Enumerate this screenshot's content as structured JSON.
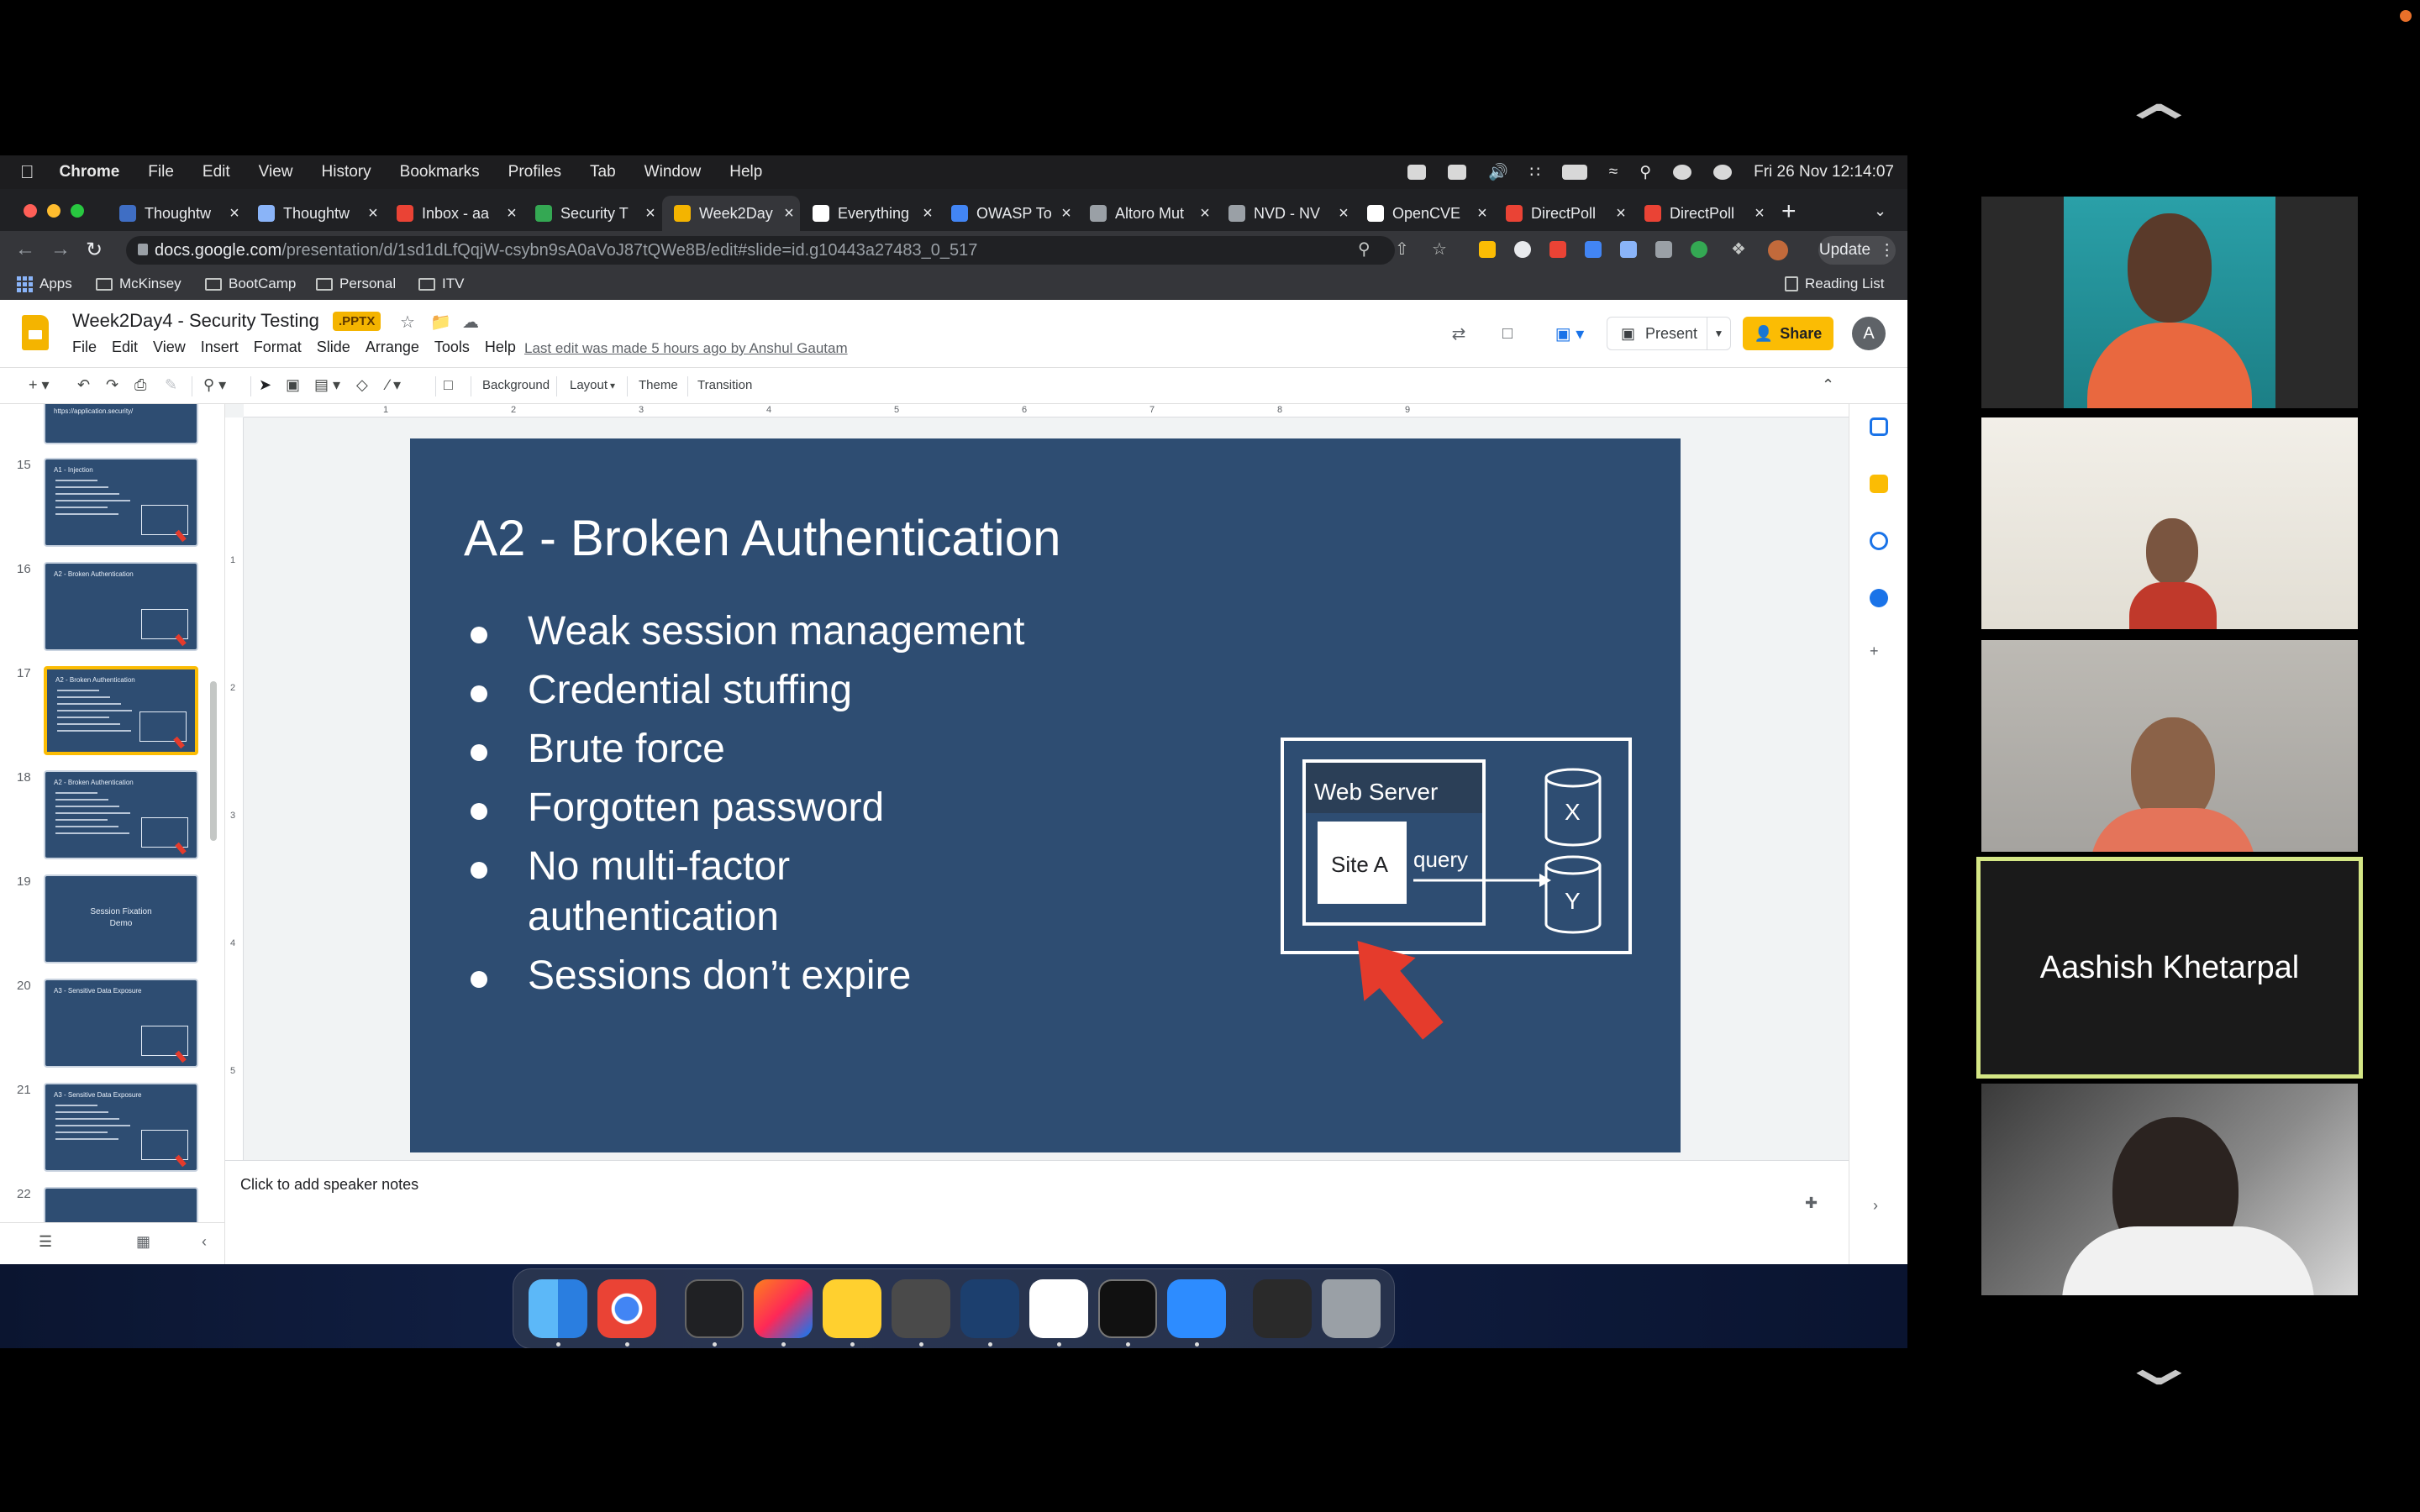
{
  "menubar": {
    "app_name": "Chrome",
    "items": [
      "File",
      "Edit",
      "View",
      "History",
      "Bookmarks",
      "Profiles",
      "Tab",
      "Window",
      "Help"
    ],
    "clock": "Fri 26 Nov  12:14:07"
  },
  "tabs": [
    {
      "label": "Thoughtw",
      "favicon_color": "#3f6ec4"
    },
    {
      "label": "Thoughtw",
      "favicon_color": "#8ab4f8"
    },
    {
      "label": "Inbox - aa",
      "favicon_color": "#ea4335"
    },
    {
      "label": "Security T",
      "favicon_color": "#34a853"
    },
    {
      "label": "Week2Day",
      "favicon_color": "#f4b400"
    },
    {
      "label": "Everything",
      "favicon_color": "#ffffff"
    },
    {
      "label": "OWASP To",
      "favicon_color": "#4285f4"
    },
    {
      "label": "Altoro Mut",
      "favicon_color": "#9aa0a6"
    },
    {
      "label": "NVD - NV",
      "favicon_color": "#9aa0a6"
    },
    {
      "label": "OpenCVE",
      "favicon_color": "#ffffff"
    },
    {
      "label": "DirectPoll",
      "favicon_color": "#ea4335"
    },
    {
      "label": "DirectPoll",
      "favicon_color": "#ea4335"
    }
  ],
  "address_bar": {
    "host": "docs.google.com",
    "path": "/presentation/d/1sd1dLfQqjW-csybn9sA0aVoJ87tQWe8B/edit#slide=id.g10443a27483_0_517",
    "update_label": "Update"
  },
  "bookmarks": {
    "apps_label": "Apps",
    "folders": [
      "McKinsey",
      "BootCamp",
      "Personal",
      "ITV"
    ],
    "reading_list": "Reading List"
  },
  "slides": {
    "doc_title": "Week2Day4 - Security Testing",
    "badge": ".PPTX",
    "menu": [
      "File",
      "Edit",
      "View",
      "Insert",
      "Format",
      "Slide",
      "Arrange",
      "Tools",
      "Help"
    ],
    "last_edit": "Last edit was made 5 hours ago by Anshul Gautam",
    "present_label": "Present",
    "share_label": "Share",
    "account_initial": "A",
    "toolbar": {
      "background": "Background",
      "layout": "Layout",
      "theme": "Theme",
      "transition": "Transition"
    },
    "notes_placeholder": "Click to add speaker notes"
  },
  "filmstrip": {
    "top_partial_text": "https://application.security/",
    "slides": [
      {
        "num": "15",
        "title": "A1 - Injection",
        "lines": 6
      },
      {
        "num": "16",
        "title": "A2 - Broken Authentication",
        "lines": 0
      },
      {
        "num": "17",
        "title": "A2 - Broken Authentication",
        "lines": 7,
        "active": true
      },
      {
        "num": "18",
        "title": "A2 - Broken Authentication",
        "lines": 7
      },
      {
        "num": "19",
        "title": "Session Fixation\nDemo",
        "lines": 0
      },
      {
        "num": "20",
        "title": "A3 - Sensitive Data Exposure",
        "lines": 0
      },
      {
        "num": "21",
        "title": "A3 - Sensitive Data Exposure",
        "lines": 6
      },
      {
        "num": "22",
        "title": "",
        "lines": 0
      }
    ]
  },
  "ruler": {
    "top": [
      "1",
      "2",
      "3",
      "4",
      "5",
      "6",
      "7",
      "8",
      "9"
    ],
    "left": [
      "1",
      "2",
      "3",
      "4",
      "5"
    ]
  },
  "slide": {
    "title": "A2 - Broken Authentication",
    "bullets": [
      "Weak session management",
      "Credential stuffing",
      "Brute force",
      "Forgotten password",
      "No multi-factor authentication",
      "Sessions don’t expire"
    ],
    "diagram": {
      "web_server": "Web Server",
      "site": "Site A",
      "query": "query",
      "db_x": "X",
      "db_y": "Y"
    },
    "background_color": "#2e4d72",
    "arrow_color": "#e53b2c"
  },
  "zoom": {
    "participants": [
      {
        "kind": "video"
      },
      {
        "kind": "video"
      },
      {
        "kind": "video"
      },
      {
        "kind": "name",
        "name": "Aashish Khetarpal",
        "active_speaker": true
      },
      {
        "kind": "video"
      }
    ]
  }
}
